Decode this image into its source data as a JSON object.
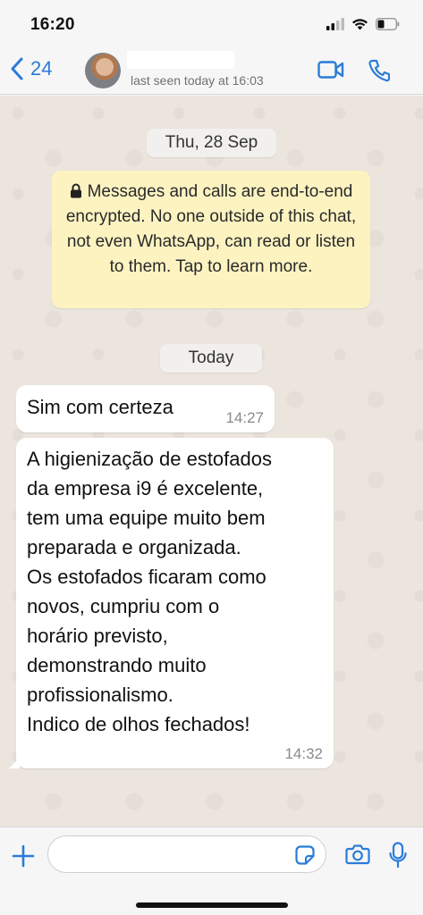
{
  "status_bar": {
    "time": "16:20"
  },
  "header": {
    "back_count": "24",
    "last_seen": "last seen today at 16:03"
  },
  "chat": {
    "date_chip_1": "Thu, 28 Sep",
    "encryption_notice": "Messages and calls are end-to-end encrypted. No one outside of this chat, not even WhatsApp, can read or listen to them. Tap to learn more.",
    "date_chip_2": "Today",
    "messages": [
      {
        "text": "Sim com certeza",
        "time": "14:27"
      },
      {
        "text": "A higienização de estofados\nda empresa i9 é excelente,\ntem uma equipe muito bem\npreparada e organizada.\nOs estofados ficaram como\nnovos, cumpriu com o\nhorário previsto,\ndemonstrando muito\nprofissionalismo.\nIndico de olhos fechados!",
        "time": "14:32"
      }
    ]
  },
  "input": {
    "placeholder": ""
  },
  "colors": {
    "accent": "#2a7cd8",
    "notice_bg": "#fcf3c1",
    "chat_bg": "#ebe5dd"
  }
}
